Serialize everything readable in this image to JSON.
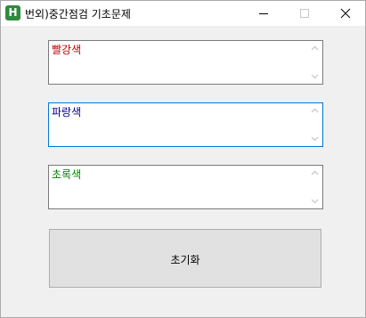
{
  "window": {
    "icon_letter": "H",
    "title": "번외)중간점검 기초문제"
  },
  "textboxes": [
    {
      "value": "빨강색",
      "color": "#c00000"
    },
    {
      "value": "파랑색",
      "color": "#00008b"
    },
    {
      "value": "초록색",
      "color": "#008000"
    }
  ],
  "reset_button": {
    "label": "초기화"
  },
  "colors": {
    "focus_border": "#0078d7",
    "window_background": "#f0f0f0",
    "button_background": "#e1e1e1"
  }
}
